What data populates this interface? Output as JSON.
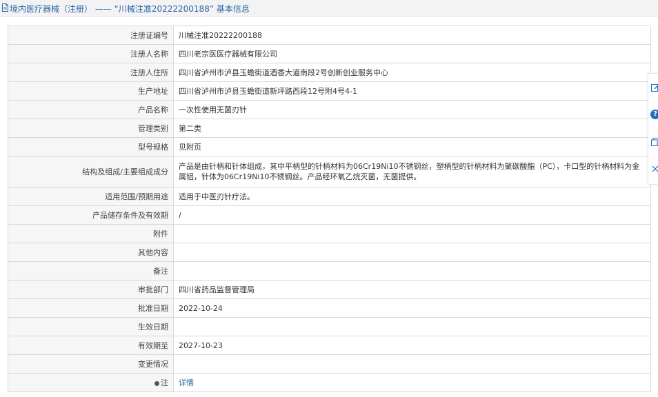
{
  "header": {
    "title": "境内医疗器械（注册） —— “川械注准20222200188” 基本信息"
  },
  "rows": [
    {
      "label": "注册证编号",
      "value": "川械注准20222200188"
    },
    {
      "label": "注册人名称",
      "value": "四川老宗医医疗器械有限公司"
    },
    {
      "label": "注册人住所",
      "value": "四川省泸州市泸县玉蟾街道酒香大道南段2号创新创业服务中心"
    },
    {
      "label": "生产地址",
      "value": "四川省泸州市泸县玉蟾街道新坪路西段12号附4号4-1"
    },
    {
      "label": "产品名称",
      "value": "一次性使用无菌刃针"
    },
    {
      "label": "管理类别",
      "value": "第二类"
    },
    {
      "label": "型号规格",
      "value": "见附页"
    },
    {
      "label": "结构及组成/主要组成成分",
      "value": "产品是由针柄和针体组成，其中平柄型的针柄材料为06Cr19Ni10不锈钢丝，塑柄型的针柄材料为聚碳酸酯（PC），卡口型的针柄材料为金属铝，针体为06Cr19Ni10不锈钢丝。产品经环氧乙烷灭菌，无菌提供。"
    },
    {
      "label": "适用范围/预期用途",
      "value": "适用于中医刃针疗法。"
    },
    {
      "label": "产品储存条件及有效期",
      "value": "/"
    },
    {
      "label": "附件",
      "value": ""
    },
    {
      "label": "其他内容",
      "value": ""
    },
    {
      "label": "备注",
      "value": ""
    },
    {
      "label": "审批部门",
      "value": "四川省药品监督管理局"
    },
    {
      "label": "批准日期",
      "value": "2022-10-24"
    },
    {
      "label": "生效日期",
      "value": ""
    },
    {
      "label": "有效期至",
      "value": "2027-10-23"
    },
    {
      "label": "变更情况",
      "value": ""
    }
  ],
  "note_row": {
    "label": "注",
    "link": "详情"
  },
  "sidebar": {
    "icons": [
      "edit-icon",
      "help-icon",
      "copy-icon",
      "close-icon"
    ],
    "help_glyph": "?"
  },
  "colors": {
    "link": "#2a66a8",
    "label_bg": "#f6f6f6",
    "border": "#d9d9d9",
    "help": "#1c6fc4"
  }
}
